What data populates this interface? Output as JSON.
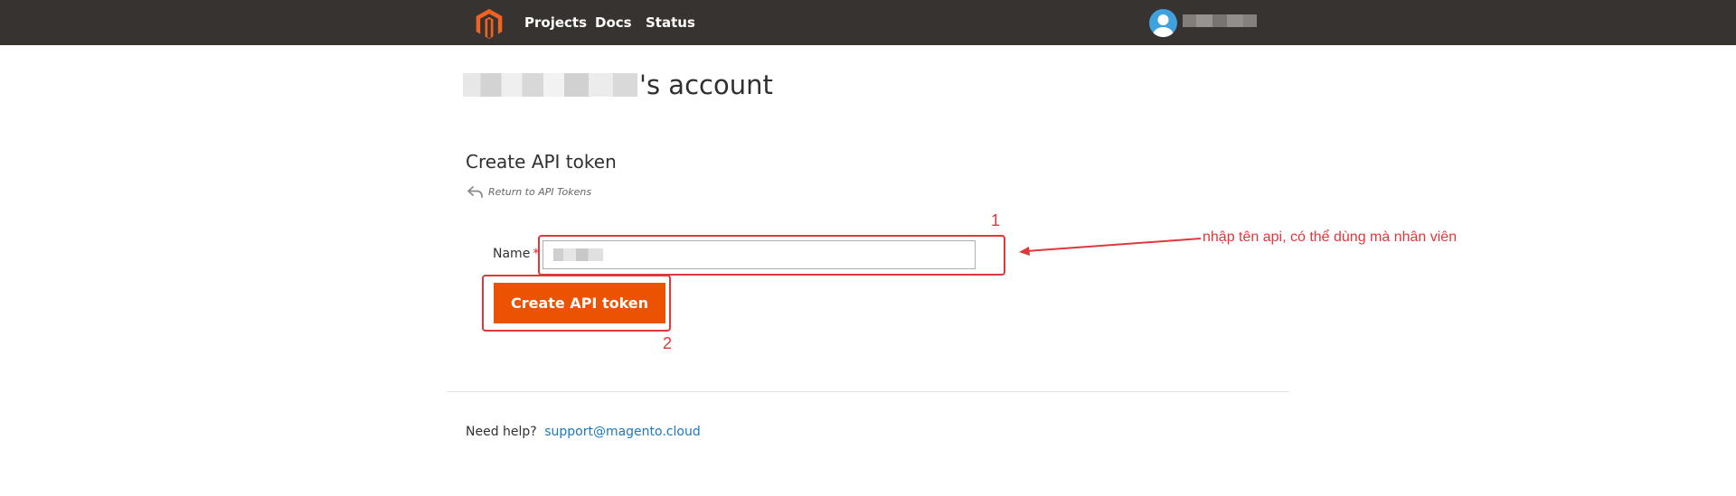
{
  "nav": {
    "items": [
      {
        "label": "Projects"
      },
      {
        "label": "Docs"
      },
      {
        "label": "Status"
      }
    ],
    "logo_icon": "magento-logo-icon",
    "avatar_icon": "user-avatar-icon"
  },
  "page": {
    "title_suffix": "'s account",
    "section_title": "Create API token",
    "return_label": "Return to API Tokens",
    "return_icon": "return-arrow-icon"
  },
  "form": {
    "name_label": "Name",
    "required_marker": "*",
    "submit_label": "Create API token"
  },
  "footer": {
    "help_text": "Need help?",
    "help_link": "support@magento.cloud"
  },
  "annotations": {
    "step1": "1",
    "step2": "2",
    "note": "nhập tên api, có thể dùng mà nhân viên"
  },
  "colors": {
    "topbar": "#373330",
    "accent": "#eb5202",
    "link": "#1979c3",
    "annotation": "#e0373b"
  }
}
